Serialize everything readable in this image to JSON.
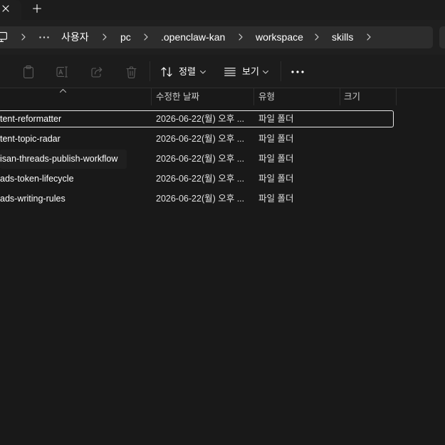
{
  "colors": {
    "window_bg": "#191919",
    "tab_strip_bg": "#1c1c1c",
    "header_bg": "#1f1f1f",
    "toolbar_bg": "#1c1c1c",
    "address_box_bg": "#2d2d2d",
    "text_primary": "#ffffff",
    "text_secondary": "#e0e0e0",
    "text_header": "#cccccc",
    "icon_disabled": "#5c5c5c",
    "focus_outline": "#e8e8e8",
    "divider": "#2e2e2e"
  },
  "tabs": {
    "active_tab_close_icon": "close-icon",
    "new_tab_icon": "plus-icon"
  },
  "address_bar": {
    "location_icon": "monitor-icon",
    "overflow_icon": "more-horizontal-icon",
    "separator_icon": "chevron-right-icon",
    "crumbs": [
      {
        "label": "사용자"
      },
      {
        "label": "pc"
      },
      {
        "label": ".openclaw-kan"
      },
      {
        "label": "workspace"
      },
      {
        "label": "skills"
      }
    ]
  },
  "toolbar": {
    "actions": [
      {
        "icon": "paste-icon",
        "enabled": false
      },
      {
        "icon": "rename-icon",
        "enabled": false
      },
      {
        "icon": "share-icon",
        "enabled": false
      },
      {
        "icon": "trash-icon",
        "enabled": false
      }
    ],
    "sort": {
      "icon": "sort-arrows-icon",
      "label": "정렬",
      "dropdown_icon": "chevron-down-icon"
    },
    "view": {
      "icon": "view-lines-icon",
      "label": "보기",
      "dropdown_icon": "chevron-down-icon"
    },
    "more_icon": "more-options-icon"
  },
  "columns": {
    "name_sort_icon": "chevron-up-icon",
    "modified": "수정한 날짜",
    "type": "유형",
    "size": "크기"
  },
  "files": [
    {
      "name": "tent-reformatter",
      "modified": "2026-06-22(월) 오후 ...",
      "type": "파일 폴더",
      "focused": true,
      "hovered": false
    },
    {
      "name": "tent-topic-radar",
      "modified": "2026-06-22(월) 오후 ...",
      "type": "파일 폴더",
      "focused": false,
      "hovered": false
    },
    {
      "name": "isan-threads-publish-workflow",
      "modified": "2026-06-22(월) 오후 ...",
      "type": "파일 폴더",
      "focused": false,
      "hovered": true
    },
    {
      "name": "ads-token-lifecycle",
      "modified": "2026-06-22(월) 오후 ...",
      "type": "파일 폴더",
      "focused": false,
      "hovered": false
    },
    {
      "name": "ads-writing-rules",
      "modified": "2026-06-22(월) 오후 ...",
      "type": "파일 폴더",
      "focused": false,
      "hovered": false
    }
  ]
}
